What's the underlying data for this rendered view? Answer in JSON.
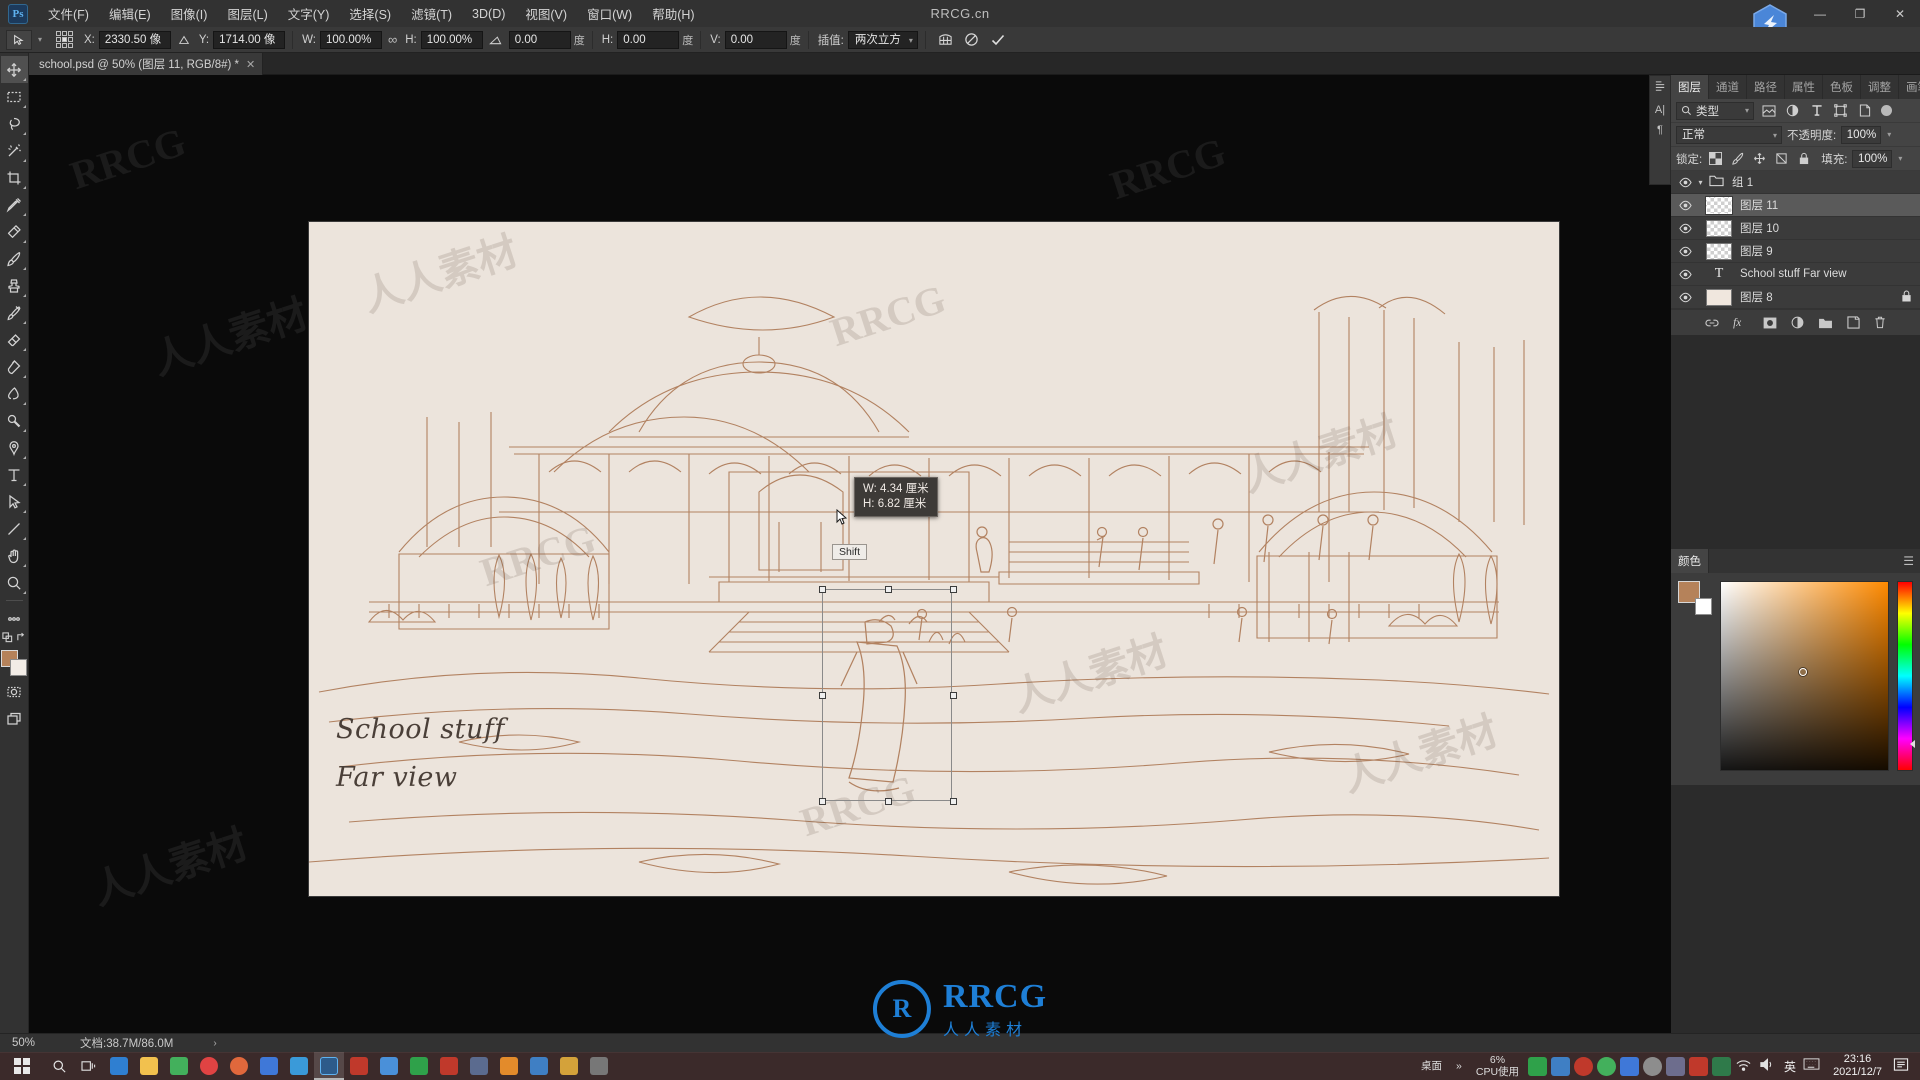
{
  "window": {
    "app_logo": "ps-logo",
    "title": "RRCG.cn",
    "minimize": "—",
    "restore": "❐",
    "close": "✕"
  },
  "menubar": {
    "items": [
      {
        "label": "文件(F)",
        "name": "menu-file"
      },
      {
        "label": "编辑(E)",
        "name": "menu-edit"
      },
      {
        "label": "图像(I)",
        "name": "menu-image"
      },
      {
        "label": "图层(L)",
        "name": "menu-layer"
      },
      {
        "label": "文字(Y)",
        "name": "menu-type"
      },
      {
        "label": "选择(S)",
        "name": "menu-select"
      },
      {
        "label": "滤镜(T)",
        "name": "menu-filter"
      },
      {
        "label": "3D(D)",
        "name": "menu-3d"
      },
      {
        "label": "视图(V)",
        "name": "menu-view"
      },
      {
        "label": "窗口(W)",
        "name": "menu-window"
      },
      {
        "label": "帮助(H)",
        "name": "menu-help"
      }
    ]
  },
  "options_bar": {
    "x_label": "X:",
    "x_value": "2330.50 像",
    "y_label": "Y:",
    "y_value": "1714.00 像",
    "w_label": "W:",
    "w_value": "100.00%",
    "link_glyph": "∞",
    "h_label": "H:",
    "h_value": "100.00%",
    "angle_label": "△",
    "angle_value": "0.00",
    "angle_unit": "度",
    "skew_h_label": "H:",
    "skew_h_value": "0.00",
    "skew_h_unit": "度",
    "skew_v_label": "V:",
    "skew_v_value": "0.00",
    "skew_v_unit": "度",
    "interp_label": "插值:",
    "interp_value": "两次立方",
    "warp_icon": "warp-icon",
    "cancel_icon": "cancel-transform-icon",
    "commit_icon": "commit-transform-icon"
  },
  "toolbar": {
    "tools": [
      {
        "name": "move-tool",
        "label": "移动工具"
      },
      {
        "name": "marquee-tool",
        "label": "矩形选框工具"
      },
      {
        "name": "lasso-tool",
        "label": "套索工具"
      },
      {
        "name": "magic-wand-tool",
        "label": "快速选择工具"
      },
      {
        "name": "crop-tool",
        "label": "裁剪工具"
      },
      {
        "name": "eyedropper-tool",
        "label": "吸管工具"
      },
      {
        "name": "healing-brush-tool",
        "label": "修复画笔工具"
      },
      {
        "name": "brush-tool",
        "label": "画笔工具"
      },
      {
        "name": "clone-stamp-tool",
        "label": "仿制图章工具"
      },
      {
        "name": "history-brush-tool",
        "label": "历史记录画笔工具"
      },
      {
        "name": "eraser-tool",
        "label": "橡皮擦工具"
      },
      {
        "name": "gradient-tool",
        "label": "渐变工具"
      },
      {
        "name": "blur-tool",
        "label": "模糊工具"
      },
      {
        "name": "dodge-tool",
        "label": "减淡工具"
      },
      {
        "name": "pen-tool",
        "label": "钢笔工具"
      },
      {
        "name": "type-tool",
        "label": "文字工具"
      },
      {
        "name": "path-selection-tool",
        "label": "路径选择工具"
      },
      {
        "name": "line-shape-tool",
        "label": "直线工具"
      },
      {
        "name": "hand-tool",
        "label": "抓手工具"
      },
      {
        "name": "zoom-tool",
        "label": "缩放工具"
      },
      {
        "name": "more-tools",
        "label": "更多"
      }
    ],
    "foreground_color": "#b5825a",
    "background_color": "#f2ece6",
    "quick-mask": "quick-mask-icon",
    "screen-mode": "screen-mode-icon"
  },
  "document_tab": {
    "label": "school.psd @ 50% (图层 11, RGB/8#) *",
    "close_glyph": "✕"
  },
  "canvas": {
    "text_line1": "School stuff",
    "text_line2": "Far view",
    "transform_tooltip": {
      "w_label": "W:",
      "w_value": "4.34 厘米",
      "h_label": "H:",
      "h_value": "6.82 厘米"
    },
    "shift_hint": "Shift"
  },
  "panels": {
    "rail_icons": [
      "history-icon",
      "character-icon",
      "paragraph-icon"
    ],
    "tabs": [
      {
        "label": "图层",
        "name": "tab-layers",
        "active": true
      },
      {
        "label": "通道",
        "name": "tab-channels",
        "active": false
      },
      {
        "label": "路径",
        "name": "tab-paths",
        "active": false
      },
      {
        "label": "属性",
        "name": "tab-properties",
        "active": false
      },
      {
        "label": "色板",
        "name": "tab-swatches",
        "active": false
      },
      {
        "label": "调整",
        "name": "tab-adjustments",
        "active": false
      },
      {
        "label": "画笔",
        "name": "tab-brushes",
        "active": false
      }
    ],
    "layers": {
      "filter_label": "类型",
      "filter_icons": [
        "pixel-filter-icon",
        "adjustment-filter-icon",
        "type-filter-icon",
        "shape-filter-icon",
        "smartobject-filter-icon"
      ],
      "blend_mode": "正常",
      "opacity_label": "不透明度:",
      "opacity_value": "100%",
      "lock_label": "锁定:",
      "lock_icons": [
        "lock-transparency-icon",
        "lock-image-icon",
        "lock-position-icon",
        "lock-artboard-icon",
        "lock-all-icon"
      ],
      "fill_label": "填充:",
      "fill_value": "100%",
      "rows": [
        {
          "name": "layer-row-group1",
          "label": "组 1",
          "kind": "group",
          "visible": true,
          "selected": false,
          "locked": false
        },
        {
          "name": "layer-row-11",
          "label": "图层 11",
          "kind": "pixel",
          "visible": true,
          "selected": true,
          "locked": false
        },
        {
          "name": "layer-row-10",
          "label": "图层 10",
          "kind": "pixel",
          "visible": true,
          "selected": false,
          "locked": false
        },
        {
          "name": "layer-row-9",
          "label": "图层 9",
          "kind": "pixel",
          "visible": true,
          "selected": false,
          "locked": false
        },
        {
          "name": "layer-row-text",
          "label": "School stuff Far view",
          "kind": "text",
          "visible": true,
          "selected": false,
          "locked": false
        },
        {
          "name": "layer-row-8",
          "label": "图层 8",
          "kind": "solid",
          "visible": true,
          "selected": false,
          "locked": true
        }
      ],
      "bottom_icons": [
        "link-layers-icon",
        "layer-style-icon",
        "layer-mask-icon",
        "adjustment-layer-icon",
        "new-group-icon",
        "new-layer-icon",
        "delete-layer-icon"
      ]
    },
    "color": {
      "tab_label": "颜色",
      "foreground": "#b5825a",
      "background": "#ffffff"
    }
  },
  "statusbar": {
    "zoom": "50%",
    "doc_info": "文档:38.7M/86.0M",
    "expand_glyph": "›"
  },
  "taskbar": {
    "start": "start-button",
    "search": "search-icon",
    "apps": [
      {
        "name": "taskview-button",
        "color": "#dcdcdc"
      },
      {
        "name": "app-edge",
        "color": "#2f7fd1"
      },
      {
        "name": "app-folder",
        "color": "#f2c14e"
      },
      {
        "name": "app-chat",
        "color": "#43b05c"
      },
      {
        "name": "app-recorder",
        "color": "#e04343"
      },
      {
        "name": "app-music",
        "color": "#e0683c"
      },
      {
        "name": "app-mail",
        "color": "#3f78d8"
      },
      {
        "name": "app-store",
        "color": "#3a9ad9"
      },
      {
        "name": "app-photoshop",
        "color": "#2d5b8a",
        "active": true
      },
      {
        "name": "app-pdf",
        "color": "#c0392b"
      },
      {
        "name": "app-cloud",
        "color": "#4a90d9"
      },
      {
        "name": "app-green",
        "color": "#2fa14a"
      },
      {
        "name": "app-wps",
        "color": "#c0392b"
      },
      {
        "name": "app-player",
        "color": "#5b6b8f"
      },
      {
        "name": "app-vlc",
        "color": "#e38b2b"
      },
      {
        "name": "app-browser",
        "color": "#3f7fc4"
      },
      {
        "name": "app-note",
        "color": "#d4a23a"
      },
      {
        "name": "app-misc",
        "color": "#777777"
      }
    ],
    "tray": {
      "desktop_label": "桌面",
      "overflow_glyph": "»",
      "cpu_value": "6%",
      "cpu_label": "CPU使用",
      "ime": "英",
      "time": "23:16",
      "date": "2021/12/7",
      "notification": "notification-icon"
    }
  },
  "watermark": {
    "brand": "RRCG",
    "brand_cn": "人人素材",
    "mark": "人人素材",
    "ring": "R"
  }
}
